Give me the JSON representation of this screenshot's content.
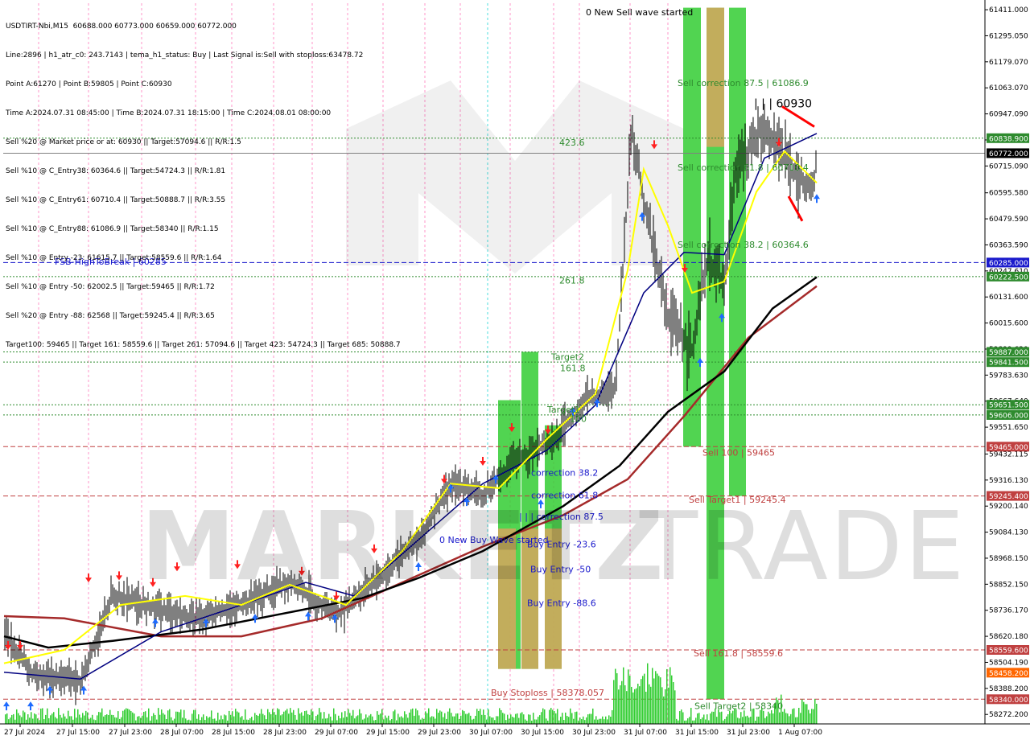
{
  "info_lines": [
    "USDTIRT-Nbi,M15  60688.000 60773.000 60659.000 60772.000",
    "Line:2896 | h1_atr_c0: 243.7143 | tema_h1_status: Buy | Last Signal is:Sell with stoploss:63478.72",
    "Point A:61270 | Point B:59805 | Point C:60930",
    "Time A:2024.07.31 08:45:00 | Time B:2024.07.31 18:15:00 | Time C:2024.08.01 08:00:00",
    "Sell %20 @ Market price or at: 60930 || Target:57094.6 || R/R:1.5",
    "Sell %10 @ C_Entry38: 60364.6 || Target:54724.3 || R/R:1.81",
    "Sell %10 @ C_Entry61: 60710.4 || Target:50888.7 || R/R:3.55",
    "Sell %10 @ C_Entry88: 61086.9 || Target:58340 || R/R:1.15",
    "Sell %10 @ Entry -23: 61615.7 || Target:58559.6 || R/R:1.64",
    "Sell %10 @ Entry -50: 62002.5 || Target:59465 || R/R:1.72",
    "Sell %20 @ Entry -88: 62568 || Target:59245.4 || R/R:3.65",
    "Target100: 59465 || Target 161: 58559.6 || Target 261: 57094.6 || Target 423: 54724.3 || Target 685: 50888.7"
  ],
  "watermark": {
    "left": "MARKETZ",
    "right": "TRADE"
  },
  "colors": {
    "background": "#ffffff",
    "candle": "#000000",
    "ema_fast": "#ffff00",
    "ema_mid": "#000080",
    "ema_slow": "#000000",
    "ema_long": "#a52a2a",
    "green_zone": "#32cd32",
    "orange_zone": "#e8a060",
    "buy_arrow": "#1e6bff",
    "sell_arrow": "#ff2020",
    "level_green": "#2e8b2e",
    "level_red": "#c04040",
    "level_blue": "#1a1acc",
    "volume": "#32cd32"
  },
  "chart_data": {
    "type": "candlestick",
    "symbol": "USDTIRT-Nbi",
    "timeframe": "M15",
    "ohlc_last": {
      "open": 60688.0,
      "high": 60773.0,
      "low": 60659.0,
      "close": 60772.0
    },
    "ylim": [
      58230,
      61440
    ],
    "y_ticks": [
      61411.0,
      61295.05,
      61179.07,
      61063.07,
      60947.09,
      60831.11,
      60715.09,
      60595.58,
      60479.59,
      60363.59,
      60247.61,
      60131.6,
      60015.6,
      59899.62,
      59783.63,
      59667.64,
      59551.65,
      59432.115,
      59316.13,
      59200.14,
      59084.13,
      58968.15,
      58852.15,
      58736.17,
      58620.18,
      58504.19,
      58388.2,
      58272.2
    ],
    "y_tick_labels": [
      "61411.000",
      "61295.050",
      "61179.070",
      "61063.070",
      "60947.090",
      "60831.110",
      "60715.090",
      "60595.580",
      "60479.590",
      "60363.590",
      "60247.610",
      "60131.600",
      "60015.600",
      "59899.620",
      "59783.630",
      "59667.640",
      "59551.650",
      "59432.115",
      "59316.130",
      "59200.140",
      "59084.130",
      "58968.150",
      "58852.150",
      "58736.170",
      "58620.180",
      "58504.190",
      "58388.200",
      "58272.200"
    ],
    "x_labels": [
      "27 Jul 2024",
      "27 Jul 15:00",
      "27 Jul 23:00",
      "28 Jul 07:00",
      "28 Jul 15:00",
      "28 Jul 23:00",
      "29 Jul 07:00",
      "29 Jul 15:00",
      "29 Jul 23:00",
      "30 Jul 07:00",
      "30 Jul 15:00",
      "30 Jul 23:00",
      "31 Jul 07:00",
      "31 Jul 15:00",
      "31 Jul 23:00",
      "1 Aug 07:00"
    ],
    "x_label_pos": [
      25,
      90,
      155,
      219,
      283,
      347,
      411,
      475,
      539,
      603,
      667,
      731,
      795,
      859,
      923,
      987
    ],
    "price_levels": [
      {
        "value": 60838.9,
        "label": "60838.900",
        "color": "#2e8b2e",
        "style": "dotted"
      },
      {
        "value": 60772.0,
        "label": "60772.000",
        "color": "#808080",
        "style": "solid",
        "current": true
      },
      {
        "value": 60285.0,
        "label": "60285.000",
        "color": "#1a1acc",
        "style": "dashed"
      },
      {
        "value": 60222.5,
        "label": "60222.500",
        "color": "#2e8b2e",
        "style": "dotted"
      },
      {
        "value": 59887.0,
        "label": "59887.000",
        "color": "#2e8b2e",
        "style": "dotted"
      },
      {
        "value": 59841.5,
        "label": "59841.500",
        "color": "#2e8b2e",
        "style": "dotted"
      },
      {
        "value": 59651.5,
        "label": "59651.500",
        "color": "#2e8b2e",
        "style": "dotted"
      },
      {
        "value": 59606.0,
        "label": "59606.000",
        "color": "#2e8b2e",
        "style": "dotted"
      },
      {
        "value": 59465.0,
        "label": "59465.000",
        "color": "#c04040",
        "style": "dashed"
      },
      {
        "value": 59245.4,
        "label": "59245.400",
        "color": "#c04040",
        "style": "dashed"
      },
      {
        "value": 58559.6,
        "label": "58559.600",
        "color": "#c04040",
        "style": "dashed"
      },
      {
        "value": 58458.2,
        "label": "58458.200",
        "color": "#ff6600",
        "style": "none"
      },
      {
        "value": 58340.0,
        "label": "58340.000",
        "color": "#c04040",
        "style": "dashed"
      }
    ],
    "annotations": [
      {
        "text": "0 New Sell wave started",
        "value": 61400,
        "color": "#000000"
      },
      {
        "text": "Sell correction 87.5 | 61086.9",
        "value": 61086,
        "color": "#2e8b2e"
      },
      {
        "text": "| | | 60930",
        "value": 60990,
        "color": "#000000"
      },
      {
        "text": "423.6",
        "value": 60820,
        "color": "#2e8b2e"
      },
      {
        "text": "Sell correction 61.8 | 60710.4",
        "value": 60710,
        "color": "#2e8b2e"
      },
      {
        "text": "FSB-HighToBreak | 60285",
        "value": 60290,
        "color": "#1a1acc"
      },
      {
        "text": "Sell correction 38.2 | 60364.6",
        "value": 60365,
        "color": "#2e8b2e"
      },
      {
        "text": "261.8",
        "value": 60205,
        "color": "#2e8b2e"
      },
      {
        "text": "Target2",
        "value": 59865,
        "color": "#2e8b2e"
      },
      {
        "text": "161.8",
        "value": 59815,
        "color": "#2e8b2e"
      },
      {
        "text": "Target1",
        "value": 59630,
        "color": "#2e8b2e"
      },
      {
        "text": "100",
        "value": 59590,
        "color": "#2e8b2e"
      },
      {
        "text": "Sell 100 | 59465",
        "value": 59440,
        "color": "#c04040"
      },
      {
        "text": "correction 38.2",
        "value": 59350,
        "color": "#1a1acc"
      },
      {
        "text": "Sell Target1 | 59245.4",
        "value": 59230,
        "color": "#c04040"
      },
      {
        "text": "correction 61.8",
        "value": 59250,
        "color": "#1a1acc"
      },
      {
        "text": "| | | correction 87.5",
        "value": 59155,
        "color": "#1a1acc"
      },
      {
        "text": "0 New Buy Wave started",
        "value": 59050,
        "color": "#1a1acc"
      },
      {
        "text": "Buy Entry -23.6",
        "value": 59030,
        "color": "#1a1acc"
      },
      {
        "text": "Buy Entry -50",
        "value": 58920,
        "color": "#1a1acc"
      },
      {
        "text": "Buy Entry -88.6",
        "value": 58770,
        "color": "#1a1acc"
      },
      {
        "text": "Sell 161.8 | 58559.6",
        "value": 58545,
        "color": "#c04040"
      },
      {
        "text": "Buy Stoploss | 58378.057",
        "value": 58370,
        "color": "#c04040"
      },
      {
        "text": "Sell Target2 | 58340",
        "value": 58310,
        "color": "#2e8b2e"
      }
    ]
  }
}
